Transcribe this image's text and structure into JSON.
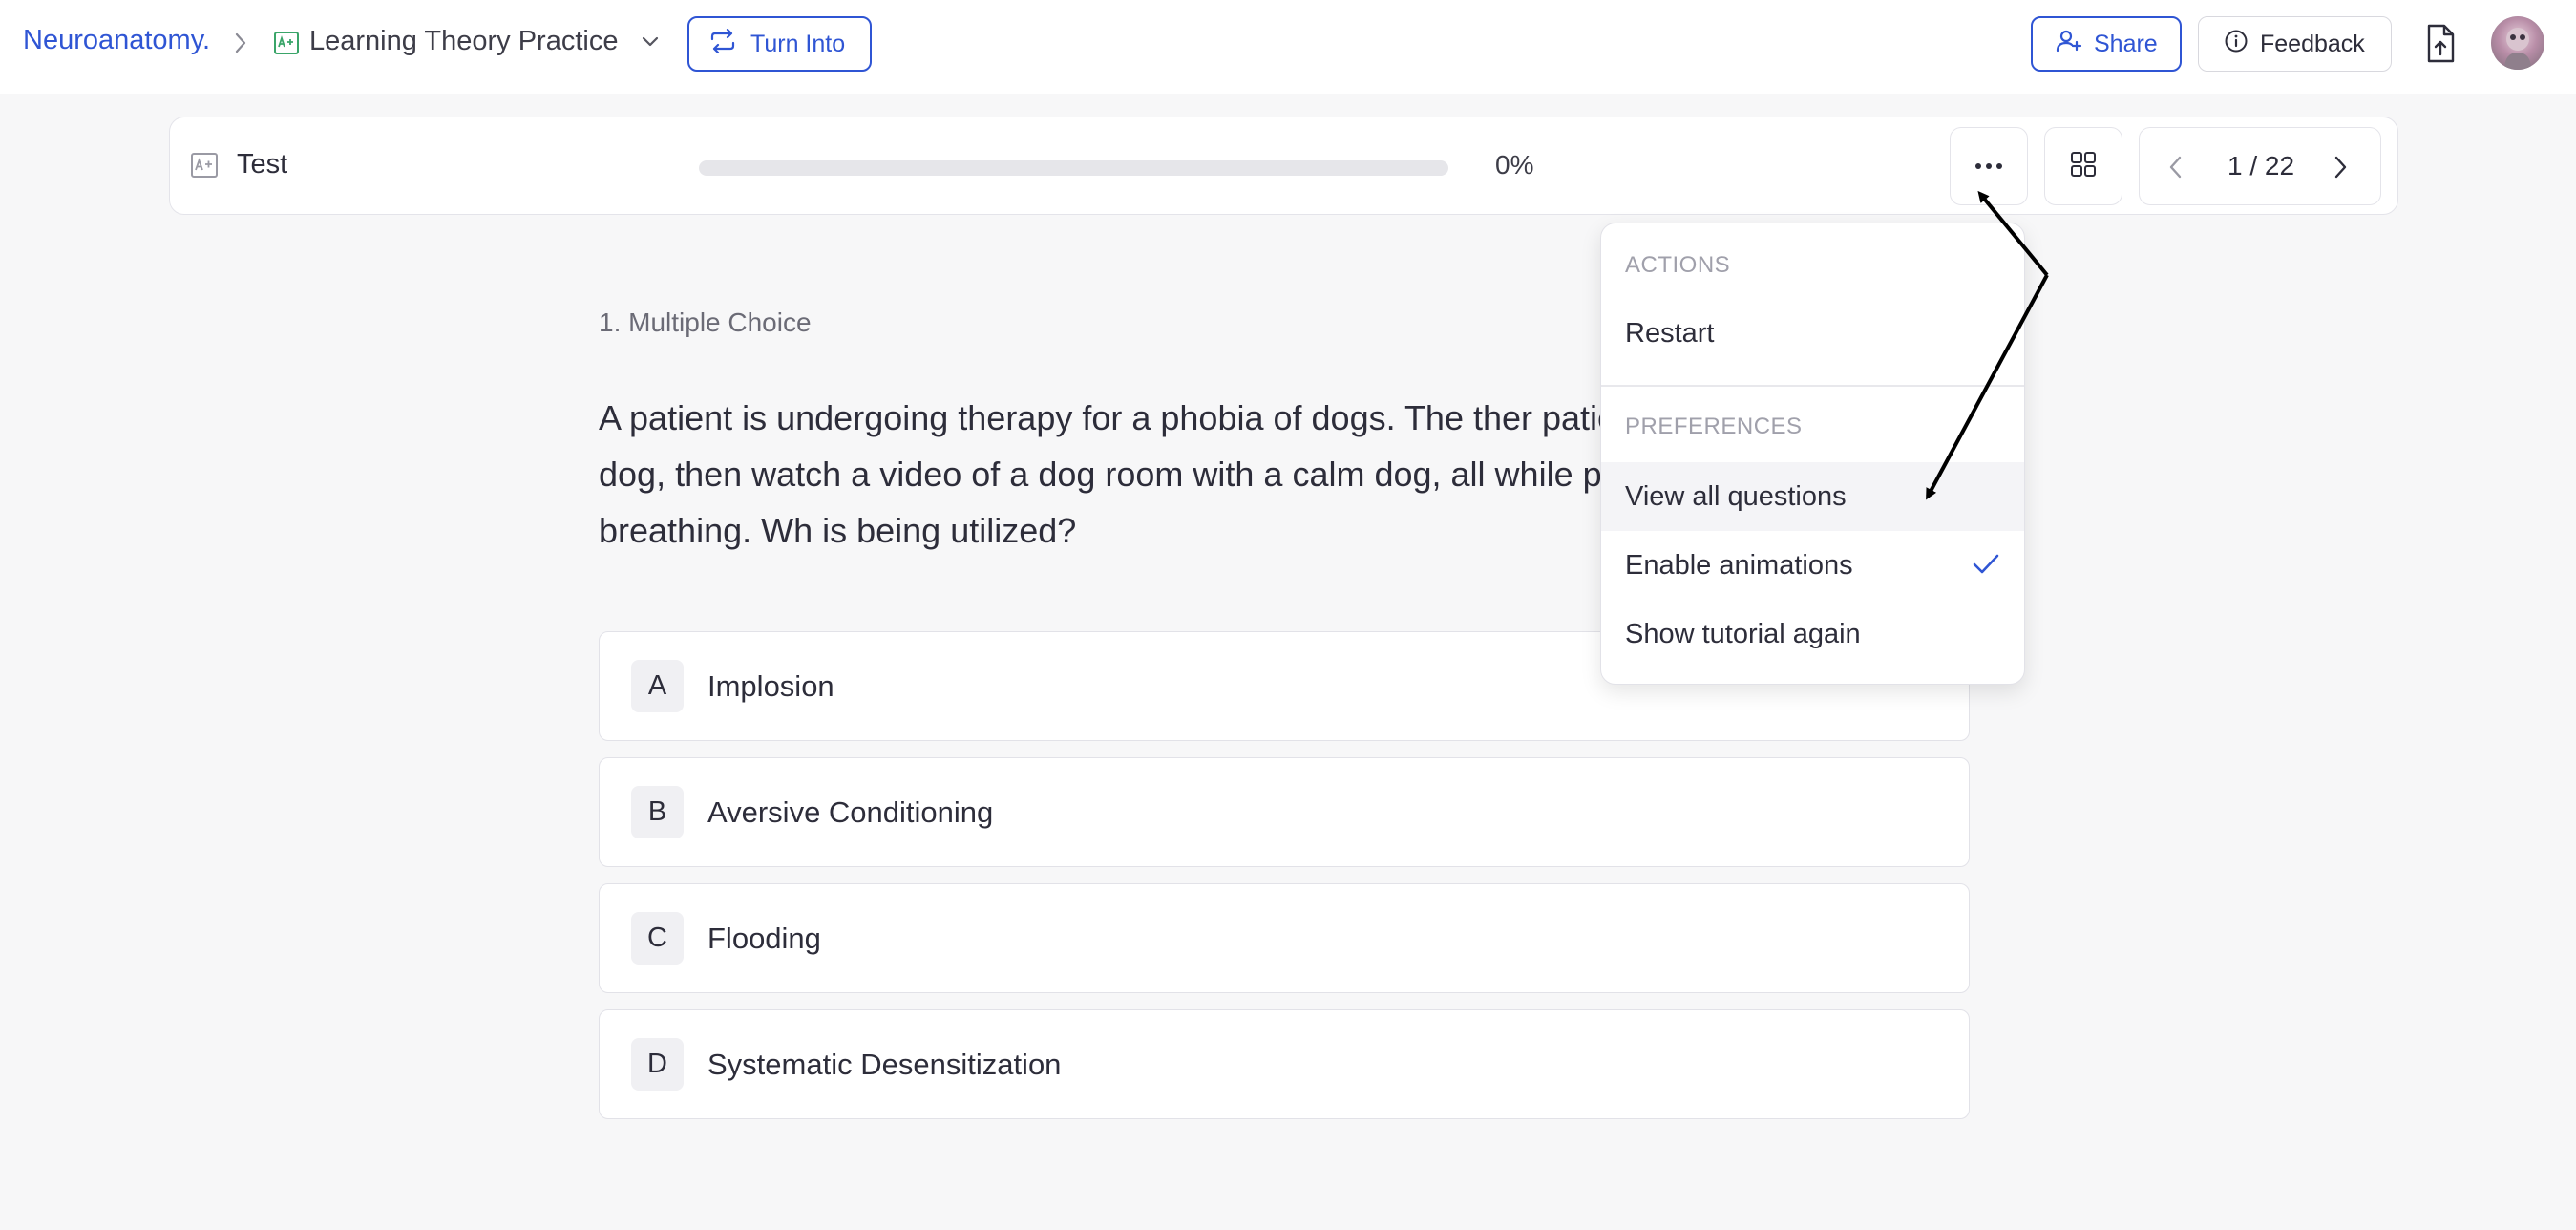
{
  "breadcrumb": {
    "root": "Neuroanatomy.",
    "current": "Learning Theory Practice"
  },
  "header": {
    "turn_into_label": "Turn Into",
    "share_label": "Share",
    "feedback_label": "Feedback"
  },
  "test": {
    "title": "Test",
    "progress_fraction": 0,
    "progress_text": "0%",
    "pager_text": "1 / 22"
  },
  "question": {
    "type_label": "1. Multiple Choice",
    "text": "A patient is undergoing therapy for a phobia of dogs. The ther patient look at a picture of a dog, then watch a video of a dog room with a calm dog, all while practicing deep breathing. Wh is being utilized?",
    "options": [
      {
        "letter": "A",
        "text": "Implosion"
      },
      {
        "letter": "B",
        "text": "Aversive Conditioning"
      },
      {
        "letter": "C",
        "text": "Flooding"
      },
      {
        "letter": "D",
        "text": "Systematic Desensitization"
      }
    ]
  },
  "menu": {
    "actions_heading": "ACTIONS",
    "restart": "Restart",
    "preferences_heading": "PREFERENCES",
    "view_all": "View all questions",
    "enable_animations": "Enable animations",
    "enable_animations_checked": true,
    "show_tutorial": "Show tutorial again"
  },
  "colors": {
    "accent": "#2f55d4",
    "doc_icon": "#3aa569",
    "background": "#f7f7f8"
  },
  "icons": {
    "breadcrumb_separator": "chevron-right-icon",
    "doc": "grade-doc-icon",
    "dropdown": "chevron-down-icon",
    "turn_into": "repeat-icon",
    "share": "user-plus-icon",
    "feedback": "info-icon",
    "export": "file-upload-icon",
    "more": "more-horizontal-icon",
    "grid": "grid-icon",
    "prev": "chevron-left-icon",
    "next": "chevron-right-icon",
    "check": "check-icon"
  }
}
